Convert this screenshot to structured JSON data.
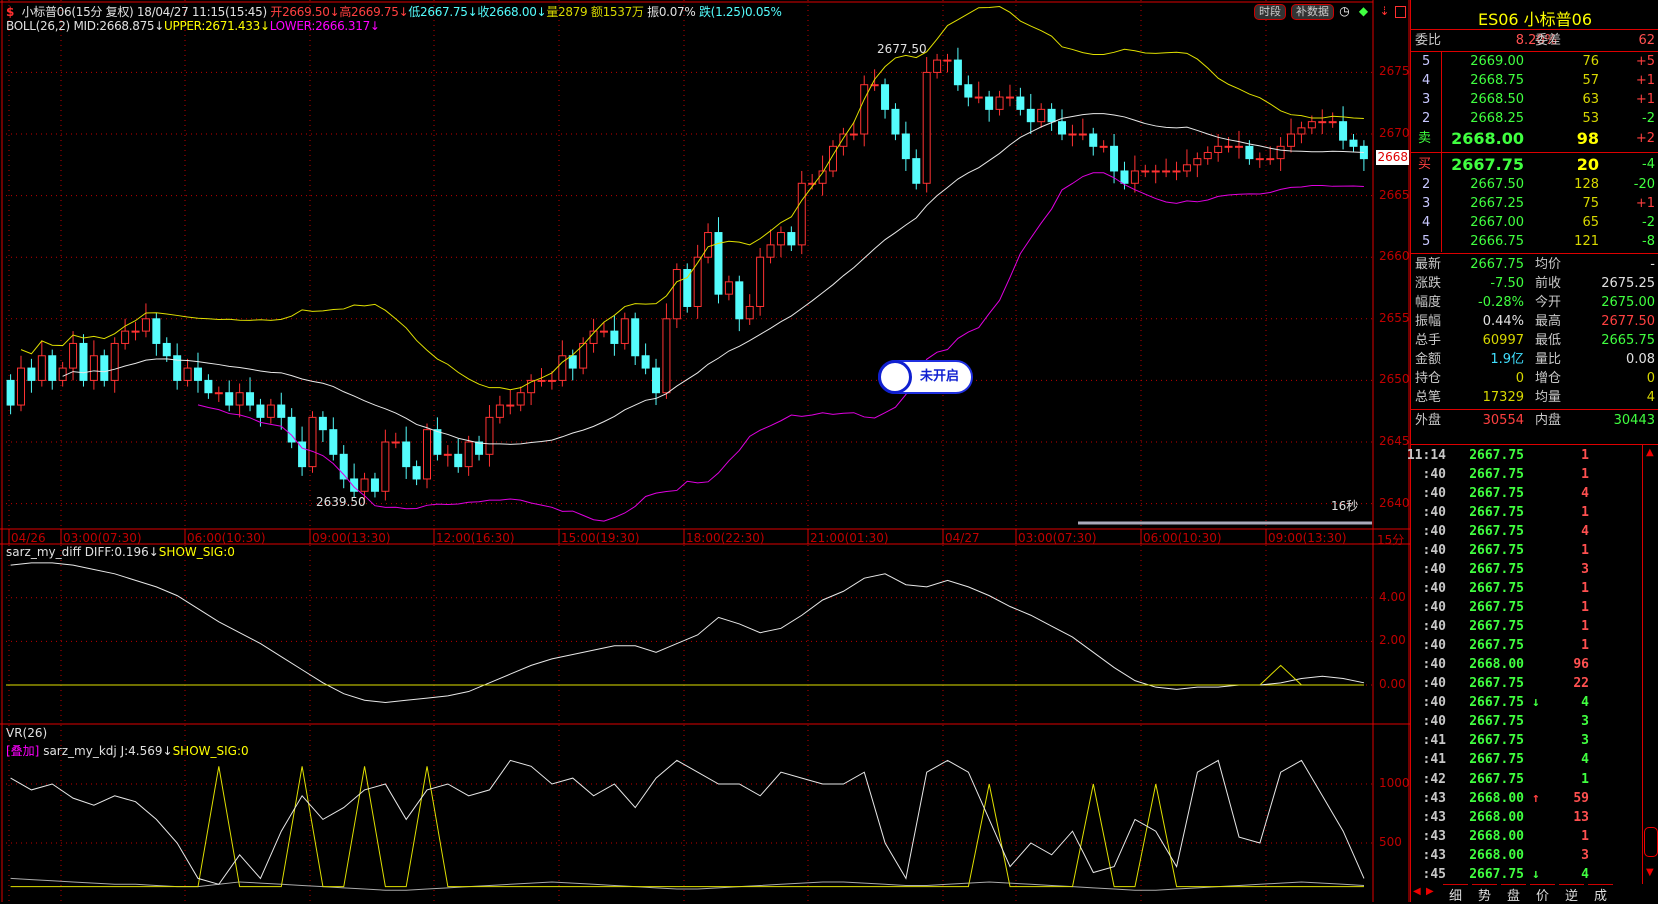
{
  "header": {
    "symbol_title": "小标普06(15分 复权)",
    "datetime": "18/04/27 11:15(15:45)",
    "open": "开2669.50↓",
    "high": "高2669.75↓",
    "low": "低2667.75↓",
    "close": "收2668.00↓",
    "volume": "量2879",
    "amount": "额1537万",
    "amplitude": "振0.07%",
    "change": "跌(1.25)0.05%",
    "boll_name": "BOLL(26,2)",
    "boll_mid": "MID:2668.875↓",
    "boll_upper": "UPPER:2671.433↓",
    "boll_lower": "LOWER:2666.317↓"
  },
  "toolbar": {
    "period_btn": "时段",
    "fill_data_btn": "补数据"
  },
  "main_chart": {
    "high_label": "2677.50",
    "low_label": "2639.50",
    "countdown": "16秒",
    "current_price_tag": "2668",
    "price_ticks": [
      "2675",
      "2670",
      "2665",
      "2660",
      "2655",
      "2650",
      "2645",
      "2640"
    ],
    "period_label": "15分",
    "time_ticks": [
      "04/26",
      "03:00(07:30)",
      "06:00(10:30)",
      "09:00(13:30)",
      "12:00(16:30)",
      "15:00(19:30)",
      "18:00(22:30)",
      "21:00(01:30)",
      "04/27",
      "03:00(07:30)",
      "06:00(10:30)",
      "09:00(13:30)"
    ],
    "badge": "未开启"
  },
  "diff_panel": {
    "name": "sarz_my_diff",
    "diff": "DIFF:0.196↓",
    "sig": "SHOW_SIG:0",
    "ticks": [
      "4.00",
      "2.00",
      "0.00"
    ]
  },
  "vr_panel": {
    "name": "VR(26)",
    "overlay_tag": "[叠加]",
    "kdj_name": "sarz_my_kdj",
    "j": "J:4.569↓",
    "sig": "SHOW_SIG:0",
    "ticks": [
      "1000",
      "500"
    ]
  },
  "quote": {
    "title": "ES06  小标普06",
    "wei_bi_label": "委比",
    "wei_bi": "8.20%",
    "wei_cha_label": "委差",
    "wei_cha": "62",
    "sell": [
      {
        "level": "5",
        "price": "2669.00",
        "vol": "76",
        "chg": "+5"
      },
      {
        "level": "4",
        "price": "2668.75",
        "vol": "57",
        "chg": "+1"
      },
      {
        "level": "3",
        "price": "2668.50",
        "vol": "63",
        "chg": "+1"
      },
      {
        "level": "2",
        "price": "2668.25",
        "vol": "53",
        "chg": "-2"
      },
      {
        "level": "卖",
        "price": "2668.00",
        "vol": "98",
        "chg": "+2"
      }
    ],
    "buy": [
      {
        "level": "买",
        "price": "2667.75",
        "vol": "20",
        "chg": "-4"
      },
      {
        "level": "2",
        "price": "2667.50",
        "vol": "128",
        "chg": "-20"
      },
      {
        "level": "3",
        "price": "2667.25",
        "vol": "75",
        "chg": "+1"
      },
      {
        "level": "4",
        "price": "2667.00",
        "vol": "65",
        "chg": "-2"
      },
      {
        "level": "5",
        "price": "2666.75",
        "vol": "121",
        "chg": "-8"
      }
    ],
    "stats": [
      {
        "l1": "最新",
        "v1": "2667.75",
        "c1": "#40ff40",
        "l2": "均价",
        "v2": "-",
        "c2": "#e0e0e0"
      },
      {
        "l1": "涨跌",
        "v1": "-7.50",
        "c1": "#40ff40",
        "l2": "前收",
        "v2": "2675.25",
        "c2": "#e0e0e0"
      },
      {
        "l1": "幅度",
        "v1": "-0.28%",
        "c1": "#40ff40",
        "l2": "今开",
        "v2": "2675.00",
        "c2": "#40ff40"
      },
      {
        "l1": "振幅",
        "v1": "0.44%",
        "c1": "#e0e0e0",
        "l2": "最高",
        "v2": "2677.50",
        "c2": "#ff4040"
      },
      {
        "l1": "总手",
        "v1": "60997",
        "c1": "#d8d800",
        "l2": "最低",
        "v2": "2665.75",
        "c2": "#40ff40"
      },
      {
        "l1": "金额",
        "v1": "1.9亿",
        "c1": "#40e0ff",
        "l2": "量比",
        "v2": "0.08",
        "c2": "#e0e0e0"
      },
      {
        "l1": "持仓",
        "v1": "0",
        "c1": "#d8d800",
        "l2": "增仓",
        "v2": "0",
        "c2": "#d8d800"
      },
      {
        "l1": "总笔",
        "v1": "17329",
        "c1": "#d8d800",
        "l2": "均量",
        "v2": "4",
        "c2": "#d8d800"
      }
    ],
    "outer_label": "外盘",
    "outer": "30554",
    "inner_label": "内盘",
    "inner": "30443"
  },
  "ticks": [
    {
      "t": "11:14",
      "p": "2667.75",
      "a": "",
      "v": "1",
      "side": "up"
    },
    {
      "t": ":40",
      "p": "2667.75",
      "a": "",
      "v": "1",
      "side": "up"
    },
    {
      "t": ":40",
      "p": "2667.75",
      "a": "",
      "v": "4",
      "side": "up"
    },
    {
      "t": ":40",
      "p": "2667.75",
      "a": "",
      "v": "1",
      "side": "up"
    },
    {
      "t": ":40",
      "p": "2667.75",
      "a": "",
      "v": "4",
      "side": "up"
    },
    {
      "t": ":40",
      "p": "2667.75",
      "a": "",
      "v": "1",
      "side": "up"
    },
    {
      "t": ":40",
      "p": "2667.75",
      "a": "",
      "v": "3",
      "side": "up"
    },
    {
      "t": ":40",
      "p": "2667.75",
      "a": "",
      "v": "1",
      "side": "up"
    },
    {
      "t": ":40",
      "p": "2667.75",
      "a": "",
      "v": "1",
      "side": "up"
    },
    {
      "t": ":40",
      "p": "2667.75",
      "a": "",
      "v": "1",
      "side": "up"
    },
    {
      "t": ":40",
      "p": "2667.75",
      "a": "",
      "v": "1",
      "side": "up"
    },
    {
      "t": ":40",
      "p": "2668.00",
      "a": "",
      "v": "96",
      "side": "up"
    },
    {
      "t": ":40",
      "p": "2667.75",
      "a": "",
      "v": "22",
      "side": "up"
    },
    {
      "t": ":40",
      "p": "2667.75",
      "a": "↓",
      "v": "4",
      "side": "down"
    },
    {
      "t": ":40",
      "p": "2667.75",
      "a": "",
      "v": "3",
      "side": "down"
    },
    {
      "t": ":41",
      "p": "2667.75",
      "a": "",
      "v": "3",
      "side": "down"
    },
    {
      "t": ":41",
      "p": "2667.75",
      "a": "",
      "v": "4",
      "side": "down"
    },
    {
      "t": ":42",
      "p": "2667.75",
      "a": "",
      "v": "1",
      "side": "down"
    },
    {
      "t": ":43",
      "p": "2668.00",
      "a": "↑",
      "v": "59",
      "side": "up"
    },
    {
      "t": ":43",
      "p": "2668.00",
      "a": "",
      "v": "13",
      "side": "up"
    },
    {
      "t": ":43",
      "p": "2668.00",
      "a": "",
      "v": "1",
      "side": "up"
    },
    {
      "t": ":43",
      "p": "2668.00",
      "a": "",
      "v": "3",
      "side": "up"
    },
    {
      "t": ":45",
      "p": "2667.75",
      "a": "↓",
      "v": "4",
      "side": "down"
    }
  ],
  "bottom_tabs": [
    "细",
    "势",
    "盘",
    "价",
    "逆",
    "成"
  ],
  "colors": {
    "up": "#ff3232",
    "down": "#54fcfc",
    "grid": "#c00000",
    "mid": "#e8e8e8",
    "upper": "#e0e000",
    "lower": "#e000e0"
  },
  "chart_data": {
    "type": "candlestick",
    "first_open": 2650,
    "closes": [
      2648,
      2651,
      2650,
      2652,
      2650,
      2651,
      2653,
      2650,
      2652,
      2650,
      2653,
      2654,
      2654,
      2655,
      2653,
      2652,
      2650,
      2651,
      2650,
      2649,
      2649,
      2648,
      2649,
      2648,
      2647,
      2648,
      2647,
      2645,
      2643,
      2647,
      2646,
      2644,
      2642,
      2641,
      2642,
      2641,
      2645,
      2645,
      2643,
      2642,
      2646,
      2644,
      2644,
      2643,
      2645,
      2644,
      2647,
      2648,
      2648,
      2649,
      2650,
      2650,
      2650,
      2652,
      2651,
      2653,
      2654,
      2654,
      2653,
      2655,
      2652,
      2651,
      2649,
      2655,
      2659,
      2656,
      2660,
      2662,
      2657,
      2658,
      2655,
      2656,
      2660,
      2661,
      2662,
      2661,
      2666,
      2666,
      2667,
      2669,
      2670,
      2670,
      2674,
      2674,
      2672,
      2670,
      2668,
      2666,
      2675,
      2676,
      2676,
      2674,
      2673,
      2673,
      2672,
      2673,
      2673,
      2672,
      2671,
      2672,
      2671,
      2670,
      2670,
      2670,
      2669,
      2669,
      2667,
      2666,
      2667,
      2667,
      2667,
      2667,
      2667,
      2667.5,
      2668,
      2668.5,
      2669,
      2669,
      2669,
      2668,
      2668,
      2668,
      2669,
      2670,
      2670.5,
      2671,
      2671,
      2671,
      2669.5,
      2669,
      2668
    ],
    "boll": {
      "period": 26,
      "k": 2
    },
    "ylim": [
      2637,
      2681
    ],
    "diff": [
      5.5,
      5.6,
      5.6,
      5.5,
      5.3,
      5.1,
      4.8,
      4.5,
      4.1,
      3.5,
      2.9,
      2.4,
      1.9,
      1.3,
      0.7,
      0.1,
      -0.4,
      -0.7,
      -0.8,
      -0.7,
      -0.6,
      -0.5,
      -0.3,
      0.1,
      0.5,
      0.9,
      1.2,
      1.4,
      1.6,
      1.8,
      1.8,
      1.5,
      1.9,
      2.3,
      3.1,
      2.8,
      2.4,
      2.6,
      3.2,
      3.9,
      4.3,
      4.9,
      5.1,
      4.6,
      4.5,
      4.8,
      4.5,
      4.1,
      3.6,
      3.2,
      2.7,
      2.2,
      1.5,
      0.8,
      0.2,
      -0.1,
      -0.2,
      -0.1,
      -0.1,
      0,
      0,
      0.1,
      0.3,
      0.4,
      0.3,
      0.1
    ],
    "diff_signal": [
      0,
      0,
      0,
      0,
      0,
      0,
      0,
      0,
      0,
      0,
      0,
      0,
      0,
      0,
      0,
      0,
      0,
      0,
      0,
      0,
      0,
      0,
      0,
      0,
      0,
      0,
      0,
      0,
      0,
      0,
      0,
      0,
      0,
      0,
      0,
      0,
      0,
      0,
      0,
      0,
      0,
      0,
      0,
      0,
      0,
      0,
      0,
      0,
      0,
      0,
      0,
      0,
      0,
      0,
      0,
      0,
      0,
      0,
      0,
      0,
      0,
      0.9,
      0,
      0,
      0,
      0
    ],
    "vr": [
      1050,
      950,
      1000,
      880,
      820,
      900,
      850,
      700,
      500,
      200,
      150,
      400,
      200,
      600,
      900,
      700,
      800,
      950,
      1000,
      700,
      950,
      1000,
      900,
      950,
      1200,
      1150,
      1000,
      1050,
      900,
      1000,
      800,
      1050,
      1200,
      1100,
      1000,
      1000,
      900,
      1100,
      1050,
      1000,
      1000,
      1100,
      500,
      200,
      1100,
      1200,
      1100,
      700,
      300,
      500,
      400,
      600,
      250,
      300,
      700,
      600,
      300,
      1100,
      1200,
      550,
      500,
      1100,
      1200,
      900,
      600,
      200
    ],
    "vr_ma": [
      200,
      190,
      180,
      170,
      160,
      150,
      150,
      140,
      130,
      130,
      150,
      170,
      160,
      150,
      140,
      130,
      120,
      110,
      100,
      100,
      110,
      120,
      130,
      140,
      150,
      160,
      170,
      160,
      150,
      140,
      130,
      120,
      110,
      110,
      120,
      130,
      140,
      150,
      160,
      170,
      170,
      160,
      150,
      140,
      140,
      150,
      160,
      170,
      160,
      150,
      140,
      130,
      120,
      110,
      100,
      100,
      110,
      120,
      130,
      140,
      150,
      160,
      170,
      160,
      150,
      140
    ],
    "kdj_j": [
      130,
      130,
      130,
      130,
      130,
      130,
      130,
      130,
      130,
      130,
      1150,
      130,
      130,
      130,
      1150,
      130,
      130,
      1150,
      130,
      130,
      1150,
      130,
      130,
      130,
      130,
      130,
      130,
      130,
      130,
      130,
      130,
      130,
      130,
      130,
      130,
      130,
      130,
      130,
      130,
      130,
      130,
      130,
      130,
      130,
      130,
      130,
      130,
      1000,
      130,
      130,
      130,
      130,
      1000,
      130,
      130,
      1000,
      130,
      130,
      130,
      130,
      130,
      130,
      130,
      130,
      130,
      130
    ]
  }
}
